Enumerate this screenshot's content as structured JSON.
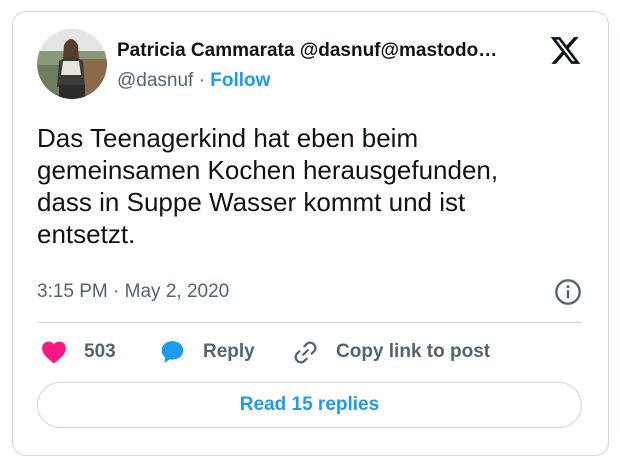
{
  "tweet": {
    "author": {
      "display_name": "Patricia Cammarata @dasnuf@mastodo…",
      "handle": "@dasnuf",
      "separator": " · ",
      "follow_label": "Follow",
      "avatar_icon": "profile-photo"
    },
    "platform_icon": "x-logo-icon",
    "text": "Das Teenagerkind hat eben beim\ngemeinsamen Kochen herausgefunden,\ndass in Suppe Wasser kommt und ist\nentsetzt.",
    "timestamp": "3:15 PM · May 2, 2020",
    "info_icon": "info-icon",
    "actions": {
      "like_count": "503",
      "reply_label": "Reply",
      "copy_label": "Copy link to post"
    },
    "read_replies_label": "Read 15 replies"
  },
  "colors": {
    "accent": "#1d9bf0",
    "like": "#f91880",
    "text": "#0f1419",
    "muted": "#536471",
    "border": "#cfd9de"
  }
}
